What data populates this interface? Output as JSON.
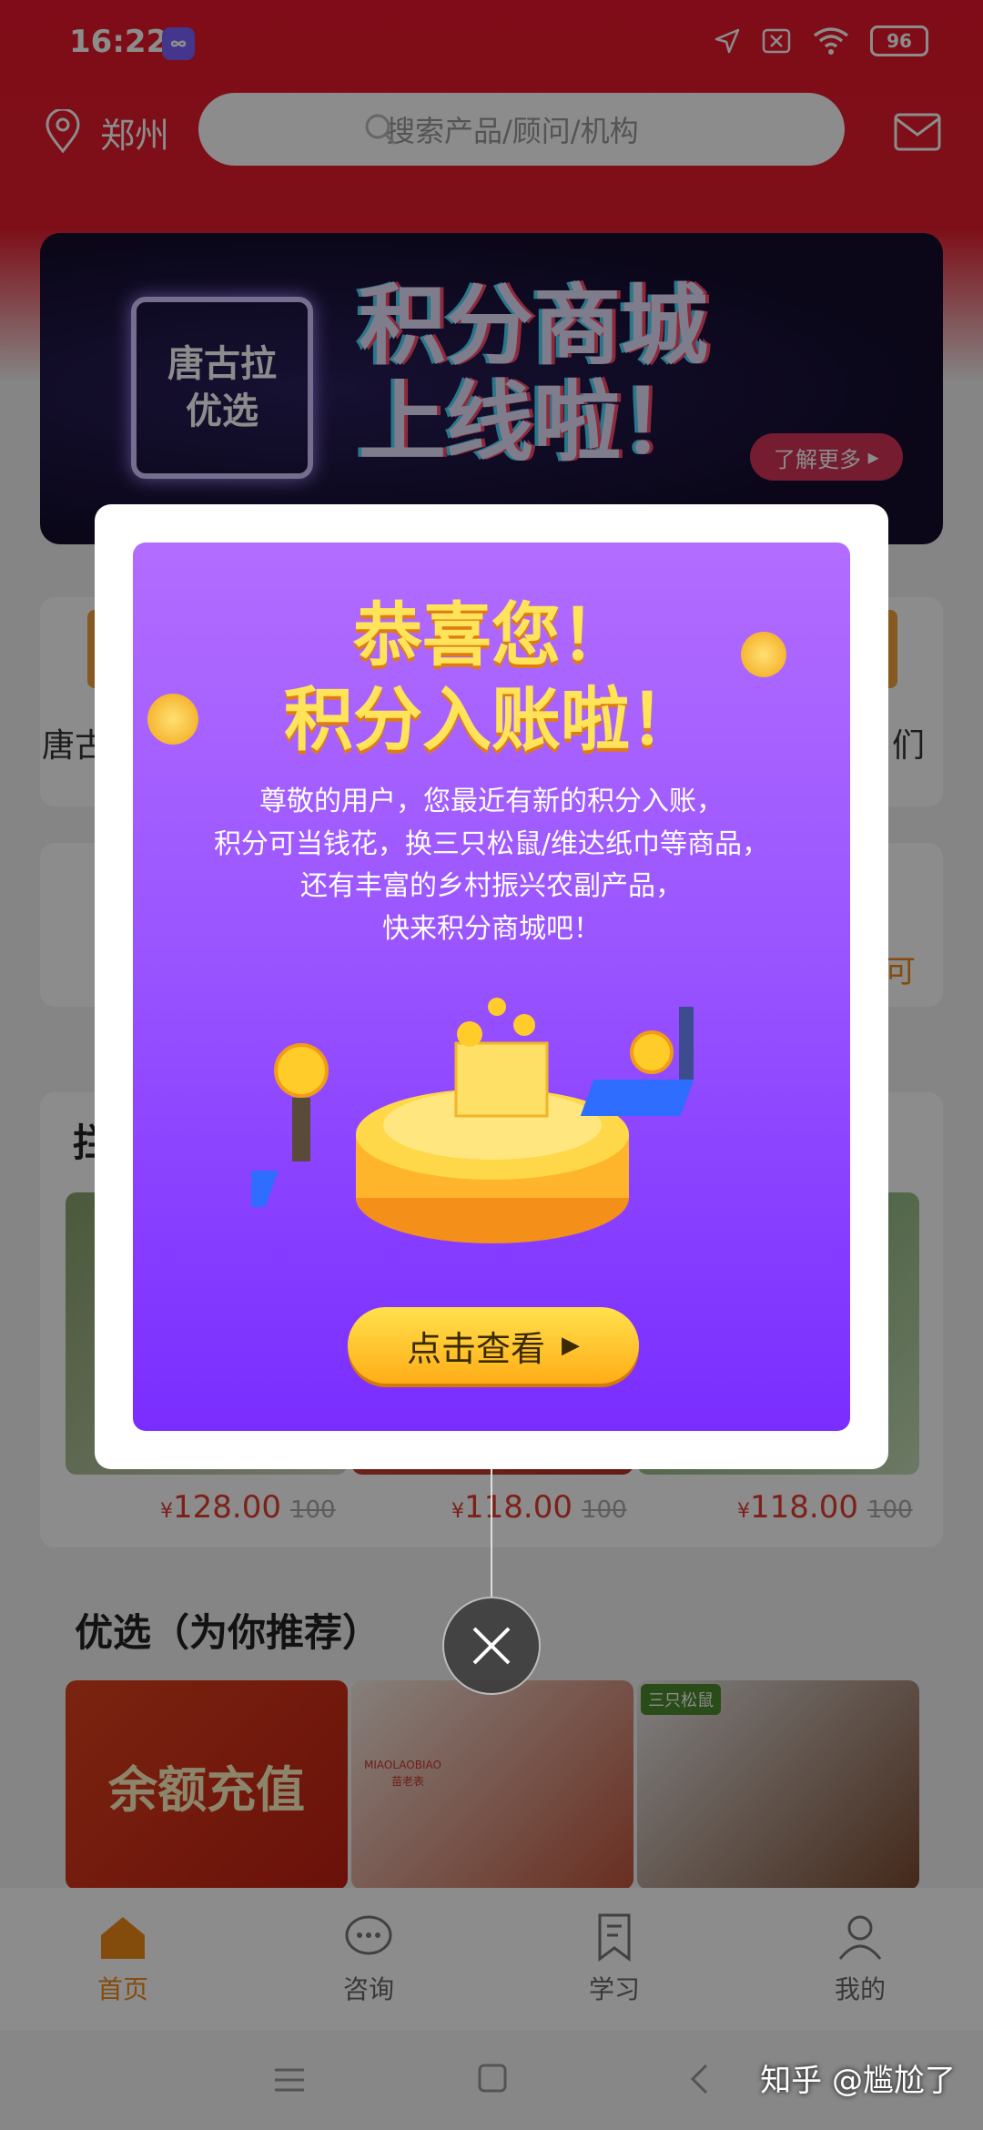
{
  "status": {
    "time": "16:22",
    "battery": "96",
    "app_icon": "infinity-icon",
    "icons": [
      "location-arrow-icon",
      "sim-off-icon",
      "wifi-icon",
      "battery-icon"
    ]
  },
  "header": {
    "city": "郑州",
    "search_placeholder": "搜索产品/顾问/机构"
  },
  "banner": {
    "chip_line1": "唐古拉",
    "chip_line2": "优选",
    "title_line1": "积分商城",
    "title_line2": "上线啦！",
    "more": "了解更多"
  },
  "background": {
    "left_label": "唐古",
    "right_label": "们",
    "side_char": "可",
    "section_head_char": "拦",
    "products": [
      {
        "price": "128.00",
        "old": "100"
      },
      {
        "price": "118.00",
        "old": "100"
      },
      {
        "price": "118.00",
        "old": "100"
      }
    ],
    "section_title": "优选（为你推荐）",
    "tile1_text": "余额充值",
    "tile2_brand": "MIAOLAOBIAO",
    "tile2_brand_cn": "苗老表",
    "tile3_brand": "三只松鼠"
  },
  "modal": {
    "title_line1": "恭喜您！",
    "title_line2": "积分入账啦！",
    "body": [
      "尊敬的用户，您最近有新的积分入账，",
      "积分可当钱花，换三只松鼠/维达纸巾等商品，",
      "还有丰富的乡村振兴农副产品，",
      "快来积分商城吧！"
    ],
    "cta": "点击查看"
  },
  "nav": {
    "items": [
      {
        "label": "首页",
        "icon": "home-icon",
        "active": true
      },
      {
        "label": "咨询",
        "icon": "chat-icon",
        "active": false
      },
      {
        "label": "学习",
        "icon": "bookmark-icon",
        "active": false
      },
      {
        "label": "我的",
        "icon": "user-icon",
        "active": false
      }
    ]
  },
  "watermark": "知乎 @尴尬了",
  "colors": {
    "brand_red": "#e8172c",
    "accent_orange": "#f08a17",
    "modal_purple": "#9a55ff",
    "title_yellow": "#ffe45a"
  }
}
